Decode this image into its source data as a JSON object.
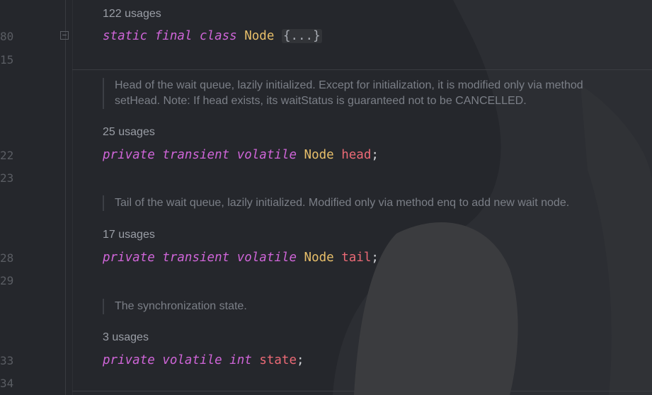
{
  "line_numbers": [
    "80",
    "15",
    "22",
    "23",
    "28",
    "29",
    "33",
    "34"
  ],
  "fold_marker": "−",
  "blocks": {
    "node_class": {
      "usages": "122 usages",
      "kw1": "static",
      "kw2": "final",
      "kw3": "class",
      "type": "Node",
      "folded": "{...}"
    },
    "head": {
      "doc": "Head of the wait queue, lazily initialized. Except for initialization, it is modified only via method setHead. Note: If head exists, its waitStatus is guaranteed not to be CANCELLED.",
      "usages": "25 usages",
      "kw1": "private",
      "kw2": "transient",
      "kw3": "volatile",
      "type": "Node",
      "name": "head",
      "semi": ";"
    },
    "tail": {
      "doc": "Tail of the wait queue, lazily initialized. Modified only via method enq to add new wait node.",
      "usages": "17 usages",
      "kw1": "private",
      "kw2": "transient",
      "kw3": "volatile",
      "type": "Node",
      "name": "tail",
      "semi": ";"
    },
    "state": {
      "doc": "The synchronization state.",
      "usages": "3 usages",
      "kw1": "private",
      "kw2": "volatile",
      "kw3": "int",
      "name": "state",
      "semi": ";"
    }
  },
  "colors": {
    "background": "#25272c",
    "keyword": "#cf65d8",
    "type": "#e8bf6a",
    "field": "#ec6a76",
    "doc": "#7b7f87",
    "usages": "#9a9ea6"
  }
}
